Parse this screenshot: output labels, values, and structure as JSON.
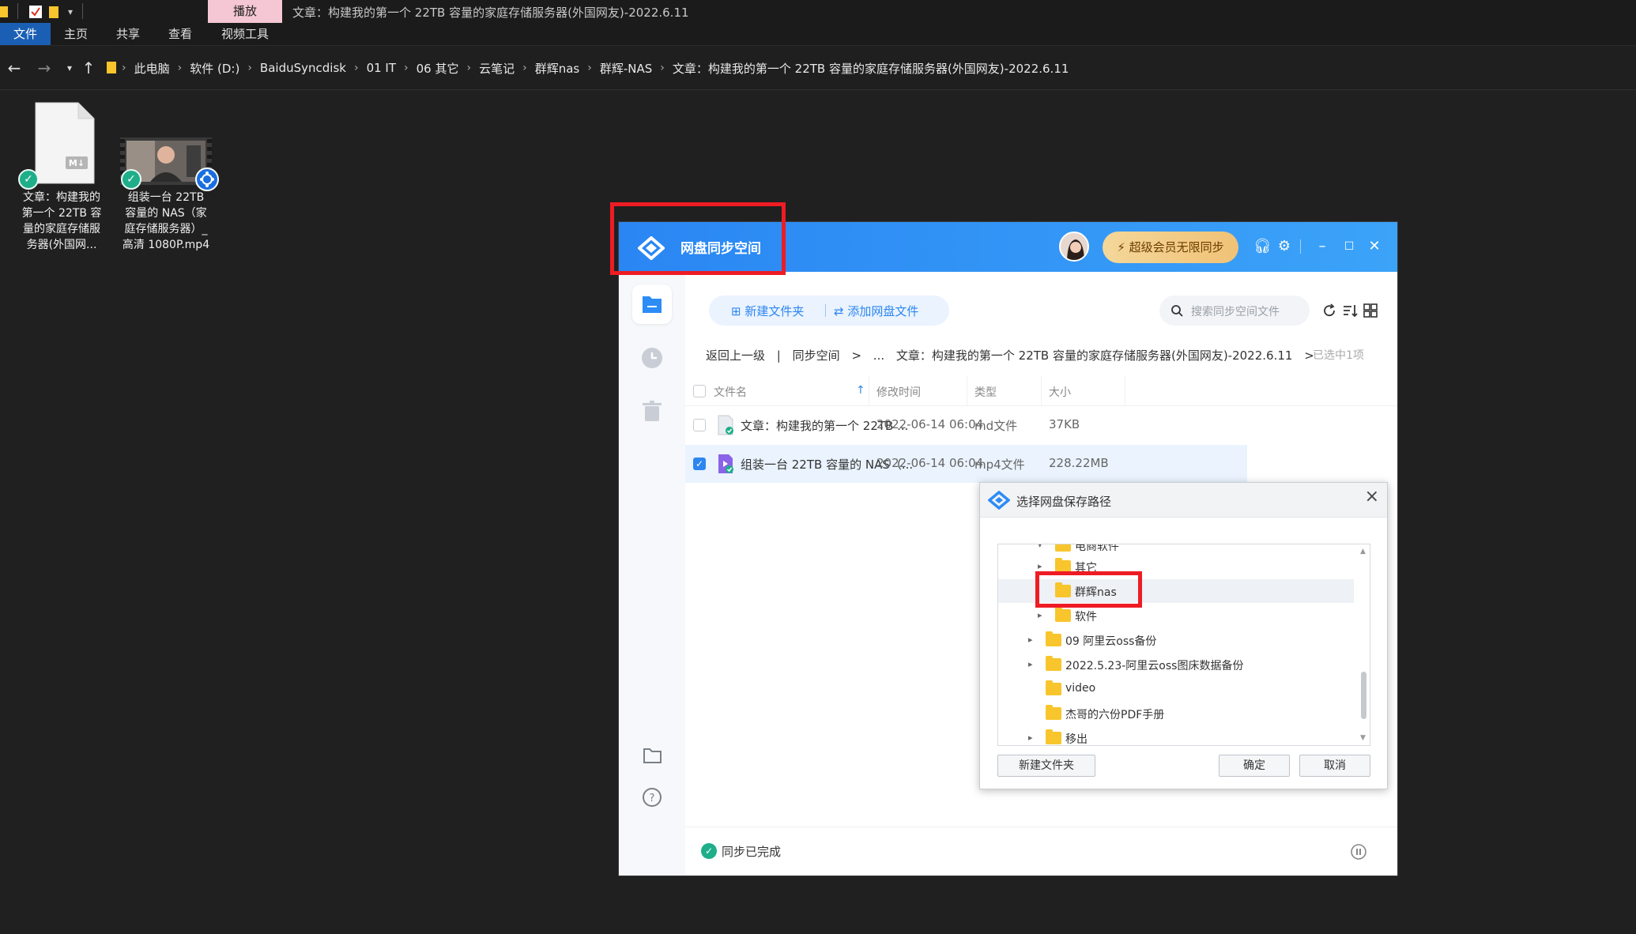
{
  "explorer": {
    "window_title": "文章：构建我的第一个 22TB 容量的家庭存储服务器(外国网友)-2022.6.11",
    "context_tab": "播放",
    "ribbon_tabs": [
      "文件",
      "主页",
      "共享",
      "查看",
      "视频工具"
    ],
    "breadcrumb": [
      "此电脑",
      "软件 (D:)",
      "BaiduSyncdisk",
      "01 IT",
      "06 其它",
      "云笔记",
      "群辉nas",
      "群辉-NAS",
      "文章：构建我的第一个 22TB 容量的家庭存储服务器(外国网友)-2022.6.11"
    ],
    "files": [
      {
        "name_lines": [
          "文章：构建我的",
          "第一个 22TB 容",
          "量的家庭存储服",
          "务器(外国网..."
        ],
        "icon": "markdown-file-icon"
      },
      {
        "name_lines": [
          "组装一台 22TB",
          "容量的 NAS（家",
          "庭存储服务器）_",
          "高清 1080P.mp4"
        ],
        "icon": "video-thumbnail-icon"
      }
    ]
  },
  "sync_app": {
    "title": "网盘同步空间",
    "vip_label": "超级会员无限同步",
    "toolbar": {
      "new_folder": "新建文件夹",
      "add_file": "添加网盘文件",
      "search_placeholder": "搜索同步空间文件"
    },
    "breadcrumb": {
      "back": "返回上一级",
      "sep": "|",
      "root": "同步空间",
      "gt1": ">",
      "ellipsis": "...",
      "current": "文章：构建我的第一个 22TB 容量的家庭存储服务器(外国网友)-2022.6.11",
      "gt2": ">"
    },
    "selected_count": "已选中1项",
    "columns": {
      "name": "文件名",
      "modified": "修改时间",
      "type": "类型",
      "size": "大小"
    },
    "rows": [
      {
        "name": "文章：构建我的第一个 22TB ...",
        "modified": "2022-06-14 06:04",
        "type": "md文件",
        "size": "37KB",
        "checked": false
      },
      {
        "name": "组装一台 22TB 容量的 NAS（...",
        "modified": "2022-06-14 06:04",
        "type": "mp4文件",
        "size": "228.22MB",
        "checked": true
      }
    ],
    "status": "同步已完成"
  },
  "dialog": {
    "title": "选择网盘保存路径",
    "tree": [
      {
        "label": "电商软件",
        "arrow": "▾"
      },
      {
        "label": "其它",
        "arrow": "▸"
      },
      {
        "label": "群辉nas",
        "arrow": ""
      },
      {
        "label": "软件",
        "arrow": "▸"
      },
      {
        "label": "09 阿里云oss备份",
        "arrow": "▸"
      },
      {
        "label": "2022.5.23-阿里云oss图床数据备份",
        "arrow": "▸"
      },
      {
        "label": "video",
        "arrow": ""
      },
      {
        "label": "杰哥的六份PDF手册",
        "arrow": ""
      },
      {
        "label": "移出",
        "arrow": "▸"
      }
    ],
    "buttons": {
      "new_folder": "新建文件夹",
      "confirm": "确定",
      "cancel": "取消"
    }
  }
}
